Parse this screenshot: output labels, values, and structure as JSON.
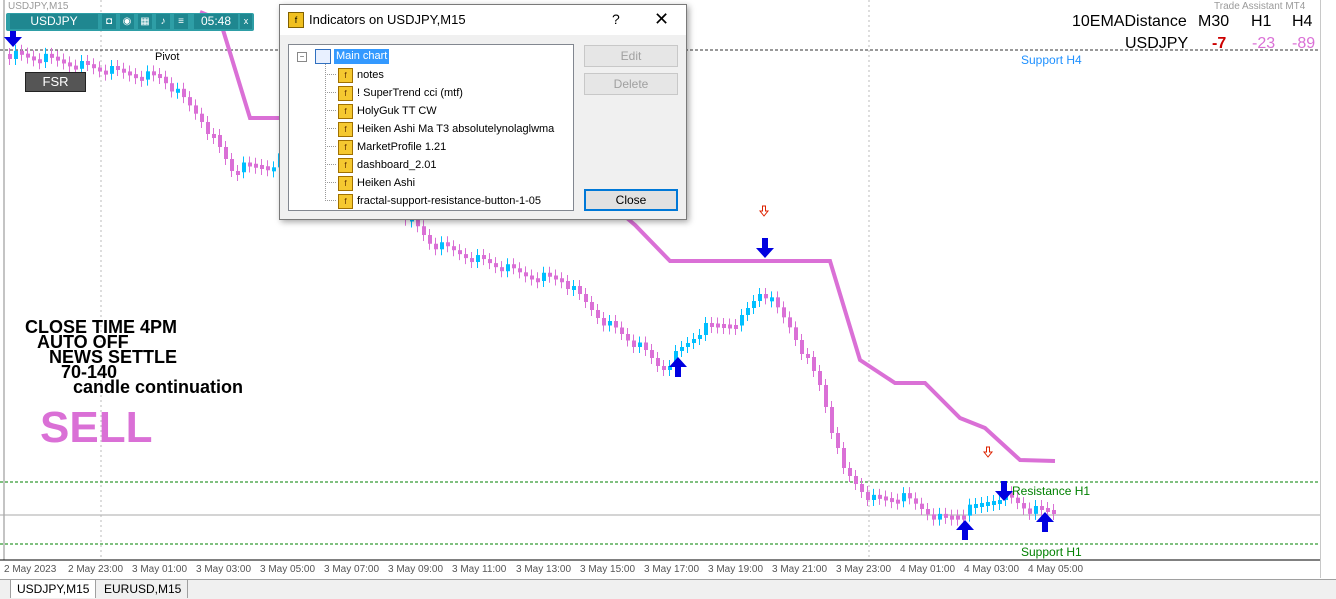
{
  "chart": {
    "top_label": "USDJPY,M15",
    "trade_assistant": "Trade Assistant MT4",
    "pivot_label": "Pivot",
    "fsr_button": "FSR",
    "toolbar": {
      "symbol": "USDJPY",
      "time": "05:48",
      "close": "x"
    },
    "notes": [
      "CLOSE TIME 4PM",
      "AUTO OFF",
      "NEWS SETTLE",
      "70-140",
      "candle continuation"
    ],
    "signal": "SELL",
    "dashboard": {
      "title": "10EMADistance",
      "col1": "M30",
      "col2": "H1",
      "col3": "H4",
      "symbol": "USDJPY",
      "v1": "-7",
      "v2": "-23",
      "v3": "-89",
      "v1_color": "#cc0000",
      "v23_color": "#da70d6"
    },
    "levels": {
      "support_h4": "Support H4",
      "resistance_h1": "Resistance H1",
      "support_h1": "Support H1"
    },
    "time_axis": [
      "2 May 2023",
      "2 May 23:00",
      "3 May 01:00",
      "3 May 03:00",
      "3 May 05:00",
      "3 May 07:00",
      "3 May 09:00",
      "3 May 11:00",
      "3 May 13:00",
      "3 May 15:00",
      "3 May 17:00",
      "3 May 19:00",
      "3 May 21:00",
      "3 May 23:00",
      "4 May 01:00",
      "4 May 03:00",
      "4 May 05:00"
    ],
    "colors": {
      "bull": "#00bfff",
      "bear": "#da70d6",
      "supertrend": "#da70d6",
      "arrow": "#0000e0"
    }
  },
  "dialog": {
    "title": "Indicators on USDJPY,M15",
    "help": "?",
    "close_x": "✕",
    "root": "Main chart",
    "items": [
      "notes",
      "! SuperTrend cci (mtf)",
      "HolyGuk TT CW",
      "Heiken Ashi Ma T3 absolutelynolaglwma",
      "MarketProfile 1.21",
      "dashboard_2.01",
      "Heiken Ashi",
      "fractal-support-resistance-button-1-05"
    ],
    "buttons": {
      "edit": "Edit",
      "delete": "Delete",
      "close": "Close"
    }
  },
  "tabs": [
    "USDJPY,M15",
    "EURUSD,M15"
  ]
}
